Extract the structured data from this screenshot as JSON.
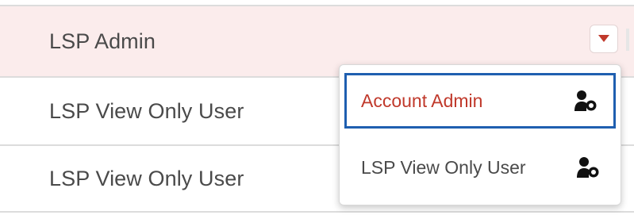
{
  "rows": [
    {
      "label": "LSP Admin",
      "selected": true
    },
    {
      "label": "LSP View Only User",
      "selected": false
    },
    {
      "label": "LSP View Only User",
      "selected": false
    }
  ],
  "dropdown": {
    "toggle_icon": "caret-down-icon",
    "options": [
      {
        "label": "Account Admin",
        "icon": "user-settings-icon",
        "highlighted": true
      },
      {
        "label": "LSP View Only User",
        "icon": "user-settings-icon",
        "highlighted": false
      }
    ]
  },
  "colors": {
    "selected_row_bg": "#fbecec",
    "accent_red": "#c0392b",
    "focus_border": "#1f5fb0",
    "text": "#4a4a4a"
  }
}
